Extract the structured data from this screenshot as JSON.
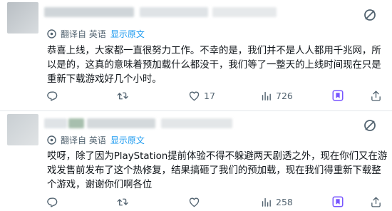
{
  "posts": [
    {
      "translate": {
        "label": "翻译自 英语",
        "show_original": "显示原文"
      },
      "text": "恭喜上线，大家都一直很努力工作。不幸的是，我们并不是人人都用千兆网，所以是的，这真的意味着预加载什么都没干，我们等了一整天的上线时间现在只是重新下载游戏好几个小时。",
      "likes": "17",
      "views": "726",
      "accent": "#7856ff"
    },
    {
      "translate": {
        "label": "翻译自 英语",
        "show_original": "显示原文"
      },
      "text": "哎呀，除了因为PlayStation提前体验不得不躲避两天剧透之外，现在你们又在游戏发售前发布了这个热修复，结果搞砸了我们的预加载，现在我们得重新下载整个游戏，谢谢你们啊各位",
      "likes": "",
      "views": "258",
      "accent": "#7856ff"
    }
  ],
  "colors": {
    "link": "#1d9bf0",
    "muted": "#536471",
    "text": "#0f1419",
    "bookmark_active": "#7856ff"
  },
  "icons": [
    "translate-icon",
    "grok-icon",
    "reply-icon",
    "retweet-icon",
    "like-icon",
    "views-icon",
    "bookmark-icon",
    "share-icon"
  ]
}
